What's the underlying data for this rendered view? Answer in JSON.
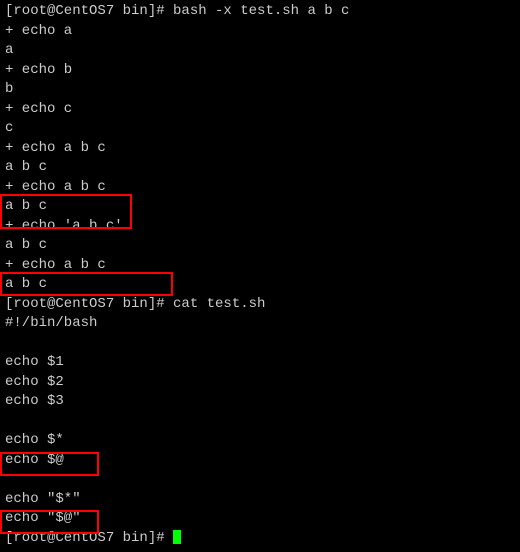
{
  "prompt1": "[root@CentOS7 bin]# bash -x test.sh a b c",
  "lines": [
    "+ echo a",
    "a",
    "+ echo b",
    "b",
    "+ echo c",
    "c",
    "+ echo a b c",
    "a b c",
    "+ echo a b c",
    "a b c",
    "+ echo 'a b c'",
    "a b c",
    "+ echo a b c",
    "a b c"
  ],
  "prompt2": "[root@CentOS7 bin]# cat test.sh",
  "script": [
    "#!/bin/bash",
    "",
    "echo $1",
    "echo $2",
    "echo $3",
    "",
    "echo $*",
    "echo $@",
    "",
    "echo \"$*\"",
    "echo \"$@\""
  ],
  "prompt3_partial": "[root@CentOS7 bin]# "
}
